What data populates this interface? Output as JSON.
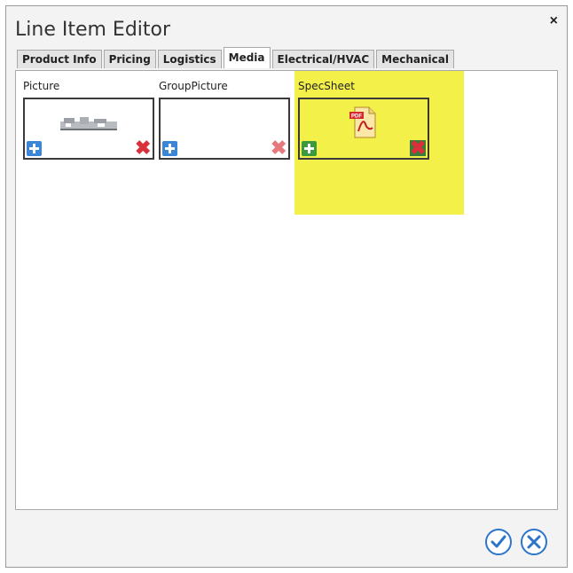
{
  "window": {
    "title": "Line Item Editor",
    "close_glyph": "×"
  },
  "tabs": [
    {
      "label": "Product Info",
      "active": false
    },
    {
      "label": "Pricing",
      "active": false
    },
    {
      "label": "Logistics",
      "active": false
    },
    {
      "label": "Media",
      "active": true
    },
    {
      "label": "Electrical/HVAC",
      "active": false
    },
    {
      "label": "Mechanical",
      "active": false
    }
  ],
  "media": {
    "slots": [
      {
        "label": "Picture",
        "has_image": true,
        "image_icon": "equipment-thumbnail-icon"
      },
      {
        "label": "GroupPicture",
        "has_image": false
      },
      {
        "label": "SpecSheet",
        "has_image": true,
        "image_icon": "pdf-document-icon",
        "highlighted": true
      }
    ]
  },
  "footer": {
    "ok_icon": "check-circle-icon",
    "cancel_icon": "x-circle-icon"
  },
  "colors": {
    "highlight": "#f4f04a",
    "accent": "#2d75c8",
    "add": "#3b86d6",
    "delete": "#d9303a"
  }
}
